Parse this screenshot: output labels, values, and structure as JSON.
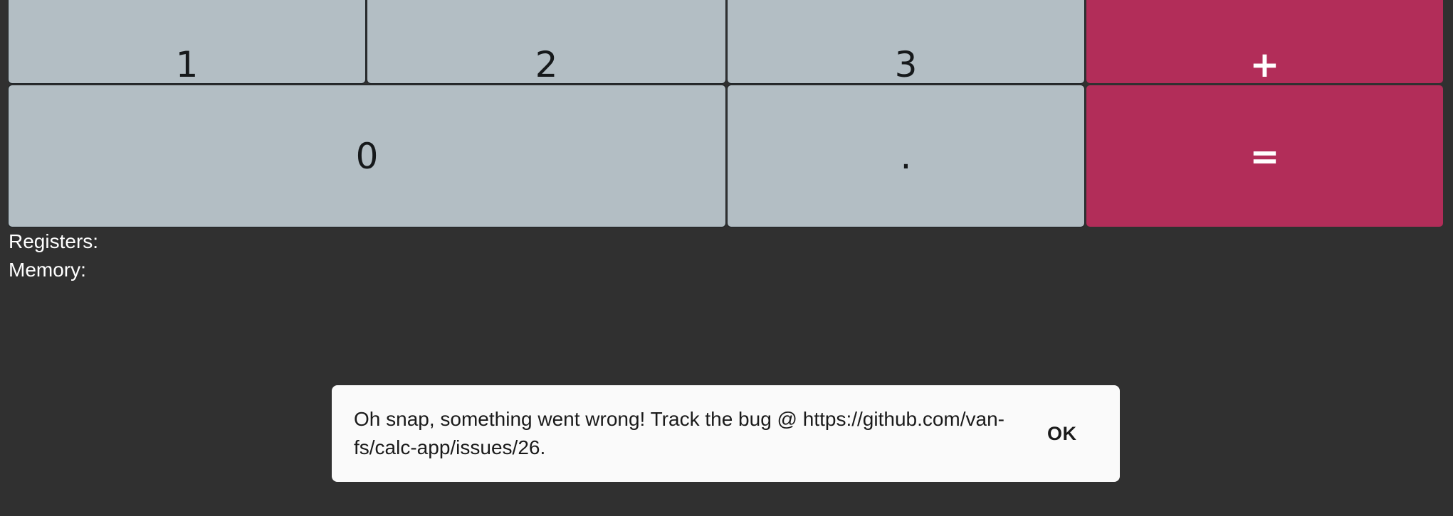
{
  "keypad": {
    "row1": [
      "1",
      "2",
      "3",
      "+"
    ],
    "row2": {
      "zero": "0",
      "decimal": ".",
      "equals": "="
    }
  },
  "info": {
    "registers_label": "Registers:",
    "memory_label": "Memory:"
  },
  "snackbar": {
    "message": "Oh snap, something went wrong! Track the bug @ https://github.com/van-fs/calc-app/issues/26.",
    "action_label": "OK"
  },
  "colors": {
    "background": "#303030",
    "key": "#b3bec4",
    "operator_key": "#b22d59",
    "snackbar": "#fafafa"
  }
}
